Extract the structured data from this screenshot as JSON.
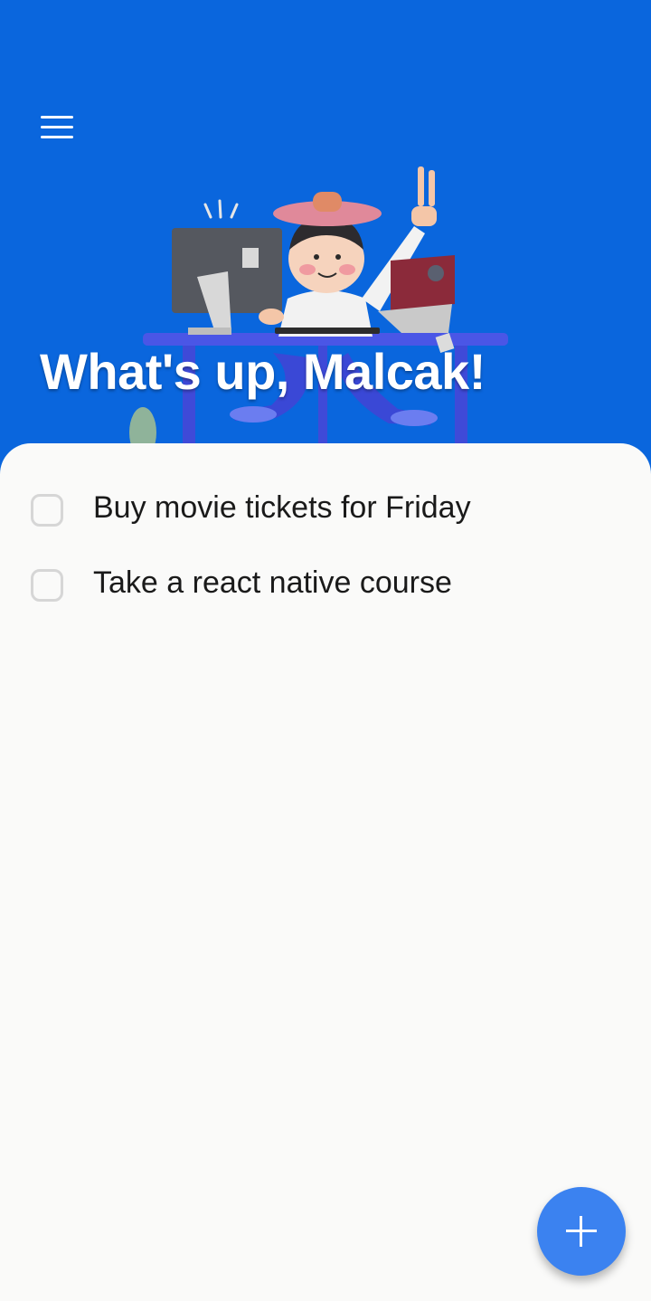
{
  "header": {
    "greeting": "What's up, Malcak!",
    "background_color": "#0a66dd",
    "menu_icon": "hamburger-menu-icon",
    "illustration": "person-at-desk-illustration"
  },
  "tasks": [
    {
      "label": "Buy movie tickets for Friday",
      "checked": false
    },
    {
      "label": "Take a react native course",
      "checked": false
    }
  ],
  "fab": {
    "icon": "plus-icon",
    "color": "#3b82f0"
  }
}
